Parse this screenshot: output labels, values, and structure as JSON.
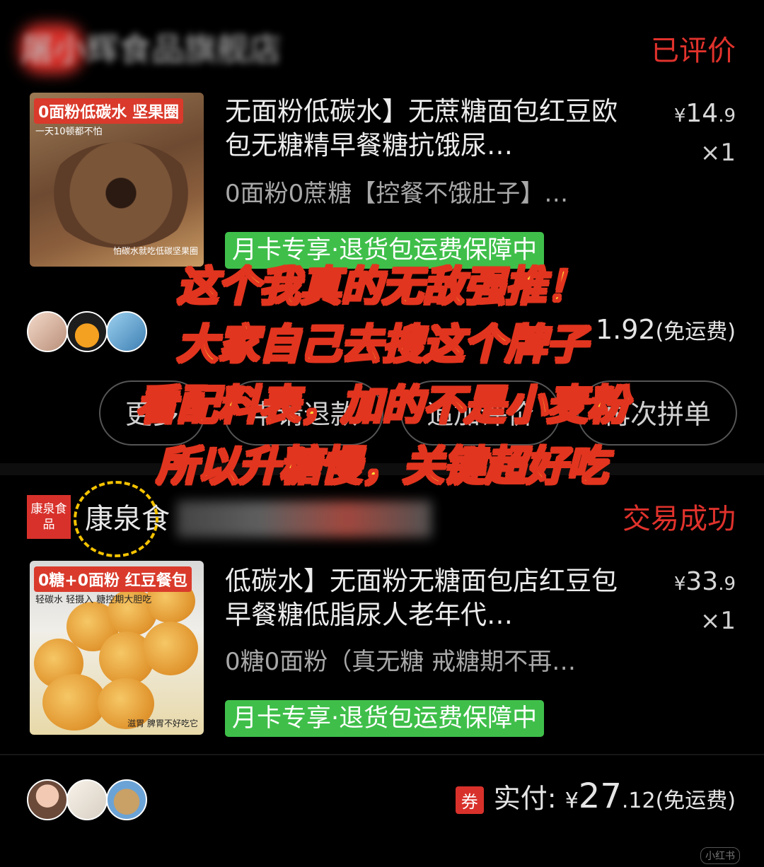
{
  "orders": [
    {
      "shop_name": "屠小辉食品旗舰店",
      "status": "已评价",
      "product": {
        "thumb_label": "0面粉低碳水 坚果圈",
        "thumb_sub": "一天10顿都不怕",
        "thumb_foot": "怕碳水就吃低碳坚果圈",
        "title": "无面粉低碳水】无蔗糖面包红豆欧包无糖精早餐糖抗饿尿…",
        "subtitle": "0面粉0蔗糖【控餐不饿肚子】…",
        "currency": "¥",
        "price_int": "14",
        "price_dec": ".9",
        "qty": "×1",
        "badge": "月卡专享·退货包运费保障中"
      },
      "payment": {
        "amount_tail": "1.92",
        "shipping": "(免运费)"
      },
      "buttons": [
        "更多",
        "申请退款",
        "追加评价",
        "再次拼单"
      ]
    },
    {
      "shop_logo_text": "康泉食品",
      "shop_name": "康泉食",
      "status": "交易成功",
      "product": {
        "thumb_label": "0糖+0面粉 红豆餐包",
        "thumb_sub": "轻碳水 轻摄入 糖控期大胆吃",
        "thumb_foot": "滋胃 脾胃不好吃它",
        "title": "低碳水】无面粉无糖面包店红豆包早餐糖低脂尿人老年代…",
        "subtitle": "0糖0面粉（真无糖 戒糖期不再…",
        "currency": "¥",
        "price_int": "33",
        "price_dec": ".9",
        "qty": "×1",
        "badge": "月卡专享·退货包运费保障中"
      },
      "payment": {
        "coupon": "券",
        "label": "实付:",
        "currency": "¥",
        "amount_int": "27",
        "amount_dec": ".12",
        "shipping": "(免运费)"
      }
    }
  ],
  "overlay_text": [
    "这个我真的无敌强推！",
    "大家自己去搜这个牌子",
    "看配料表，加的不是小麦粉",
    "所以升糖慢，关键超好吃"
  ],
  "watermark": "小红书",
  "colors": {
    "status_red": "#e0322c",
    "badge_green": "#3fbf4a",
    "overlay_yellow": "#ffe23a",
    "overlay_stroke": "#e2351f",
    "annotation_yellow": "#f5c300"
  }
}
